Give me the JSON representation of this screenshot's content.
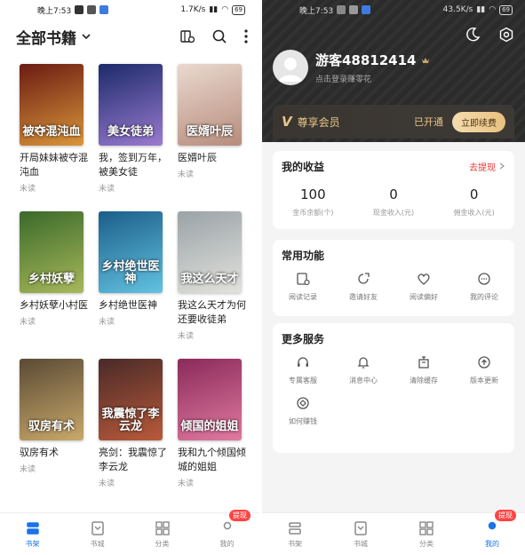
{
  "left": {
    "status_bar": {
      "time": "晚上7:53",
      "net_speed": "1.7K/s",
      "battery": "69"
    },
    "header": {
      "title": "全部书籍"
    },
    "books": [
      {
        "title": "开局妹妹被夺混沌血",
        "cover_text": "被夺混沌血",
        "status": "未读",
        "c1": "#6b1b12",
        "c2": "#d9963a"
      },
      {
        "title": "我，签到万年，被美女徒",
        "cover_text": "美女徒弟",
        "status": "未读",
        "c1": "#1c2a6a",
        "c2": "#9a7bd0"
      },
      {
        "title": "医婿叶辰",
        "cover_text": "医婿叶辰",
        "status": "未读",
        "c1": "#ead9cf",
        "c2": "#b78c7c"
      },
      {
        "title": "乡村妖孽小村医",
        "cover_text": "乡村妖孽",
        "status": "未读",
        "c1": "#3a6a2a",
        "c2": "#a8b85a"
      },
      {
        "title": "乡村绝世医神",
        "cover_text": "乡村绝世医神",
        "status": "未读",
        "c1": "#1b5e8a",
        "c2": "#63c2e0"
      },
      {
        "title": "我这么天才为何还要收徒弟",
        "cover_text": "我这么天才",
        "status": "未读",
        "c1": "#9aa3a8",
        "c2": "#e2e2dc"
      },
      {
        "title": "驭房有术",
        "cover_text": "驭房有术",
        "status": "未读",
        "c1": "#5a4a35",
        "c2": "#c9a96a"
      },
      {
        "title": "亮剑：我震惊了李云龙",
        "cover_text": "我震惊了李云龙",
        "status": "未读",
        "c1": "#4a2a28",
        "c2": "#b85a3a"
      },
      {
        "title": "我和九个倾国倾城的姐姐",
        "cover_text": "倾国的姐姐",
        "status": "未读",
        "c1": "#8a2a5a",
        "c2": "#e07aa0"
      }
    ],
    "nav": [
      {
        "label": "书架",
        "active": true
      },
      {
        "label": "书城",
        "active": false
      },
      {
        "label": "分类",
        "active": false
      },
      {
        "label": "我的",
        "active": false,
        "badge": "提现"
      }
    ]
  },
  "right": {
    "status_bar": {
      "time": "晚上7:53",
      "net_speed": "43.5K/s",
      "battery": "69"
    },
    "user": {
      "name": "游客48812414",
      "subtitle": "点击登录赚零花"
    },
    "vip": {
      "mark": "V",
      "label": "尊享会员",
      "status": "已开通",
      "renew": "立即续费"
    },
    "earnings": {
      "title": "我的收益",
      "link": "去提现",
      "items": [
        {
          "value": "100",
          "label": "金币余额(个)"
        },
        {
          "value": "0",
          "label": "现金收入(元)"
        },
        {
          "value": "0",
          "label": "佣金收入(元)"
        }
      ]
    },
    "common": {
      "title": "常用功能",
      "items": [
        {
          "label": "阅读记录",
          "icon": "reading-history-icon"
        },
        {
          "label": "邀请好友",
          "icon": "invite-icon"
        },
        {
          "label": "阅读偏好",
          "icon": "heart-icon"
        },
        {
          "label": "我的评论",
          "icon": "comment-icon"
        }
      ]
    },
    "more": {
      "title": "更多服务",
      "items": [
        {
          "label": "专属客服",
          "icon": "headset-icon"
        },
        {
          "label": "消息中心",
          "icon": "bell-icon"
        },
        {
          "label": "清除缓存",
          "icon": "trash-icon"
        },
        {
          "label": "版本更新",
          "icon": "upload-icon"
        },
        {
          "label": "如何赚钱",
          "icon": "coin-icon"
        }
      ]
    },
    "nav": [
      {
        "label": "书架",
        "active": false
      },
      {
        "label": "书城",
        "active": false
      },
      {
        "label": "分类",
        "active": false
      },
      {
        "label": "我的",
        "active": true,
        "badge": "提现"
      }
    ]
  }
}
